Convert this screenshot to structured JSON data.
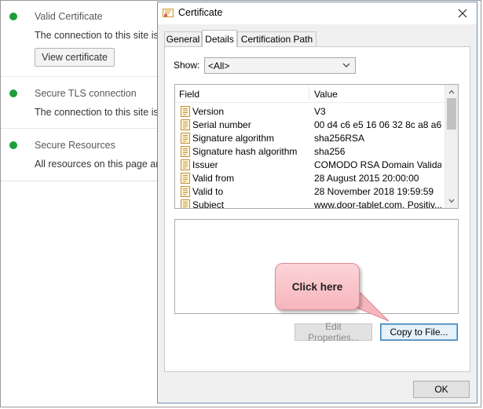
{
  "background": {
    "sections": [
      {
        "title": "Valid Certificate",
        "text": "The connection to this site is u",
        "button": "View certificate"
      },
      {
        "title": "Secure TLS connection",
        "text": "The connection to this site is u"
      },
      {
        "title": "Secure Resources",
        "text": "All resources on this page are"
      }
    ],
    "status_color": "#1e9e3a"
  },
  "dialog": {
    "title": "Certificate",
    "close_icon": "close-icon",
    "tabs": [
      {
        "label": "General",
        "active": false
      },
      {
        "label": "Details",
        "active": true
      },
      {
        "label": "Certification Path",
        "active": false
      }
    ],
    "show_label": "Show:",
    "show_value": "<All>",
    "columns": {
      "field": "Field",
      "value": "Value"
    },
    "rows": [
      {
        "field": "Version",
        "value": "V3"
      },
      {
        "field": "Serial number",
        "value": "00 d4 c6 e5 16 06 32 8c a8 a6..."
      },
      {
        "field": "Signature algorithm",
        "value": "sha256RSA"
      },
      {
        "field": "Signature hash algorithm",
        "value": "sha256"
      },
      {
        "field": "Issuer",
        "value": "COMODO RSA Domain Validati..."
      },
      {
        "field": "Valid from",
        "value": "28 August 2015 20:00:00"
      },
      {
        "field": "Valid to",
        "value": "28 November 2018 19:59:59"
      },
      {
        "field": "Subject",
        "value": "www.door-tablet.com, Positiv..."
      }
    ],
    "buttons": {
      "edit_properties": "Edit Properties...",
      "copy_to_file": "Copy to File...",
      "ok": "OK"
    }
  },
  "annotation": {
    "text": "Click here",
    "color": "#f6b6bd"
  }
}
